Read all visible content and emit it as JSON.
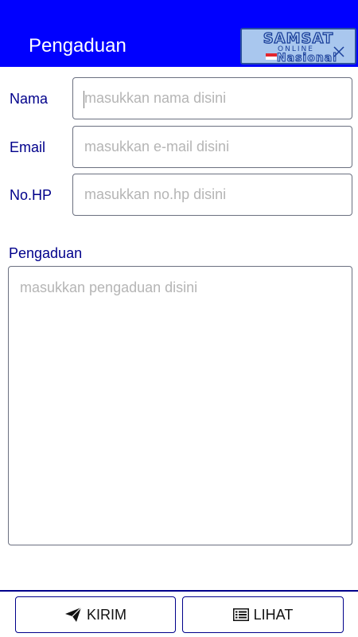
{
  "app_bar": {
    "title": "Pengaduan",
    "background": "#0000ff",
    "logo": {
      "line1": "SAMSAT",
      "line2": "ONLINE",
      "line3": "Nasional"
    }
  },
  "form": {
    "nama": {
      "label": "Nama",
      "placeholder": "masukkan nama disini"
    },
    "email": {
      "label": "Email",
      "placeholder": "masukkan e-mail disini"
    },
    "nohp": {
      "label": "No.HP",
      "placeholder": "masukkan no.hp disini"
    },
    "pengaduan": {
      "label": "Pengaduan",
      "placeholder": "masukkan pengaduan disini"
    },
    "label_color": "#00008b"
  },
  "actions": {
    "kirim": {
      "label": "KIRIM",
      "icon": "send-icon"
    },
    "lihat": {
      "label": "LIHAT",
      "icon": "list-icon"
    }
  }
}
